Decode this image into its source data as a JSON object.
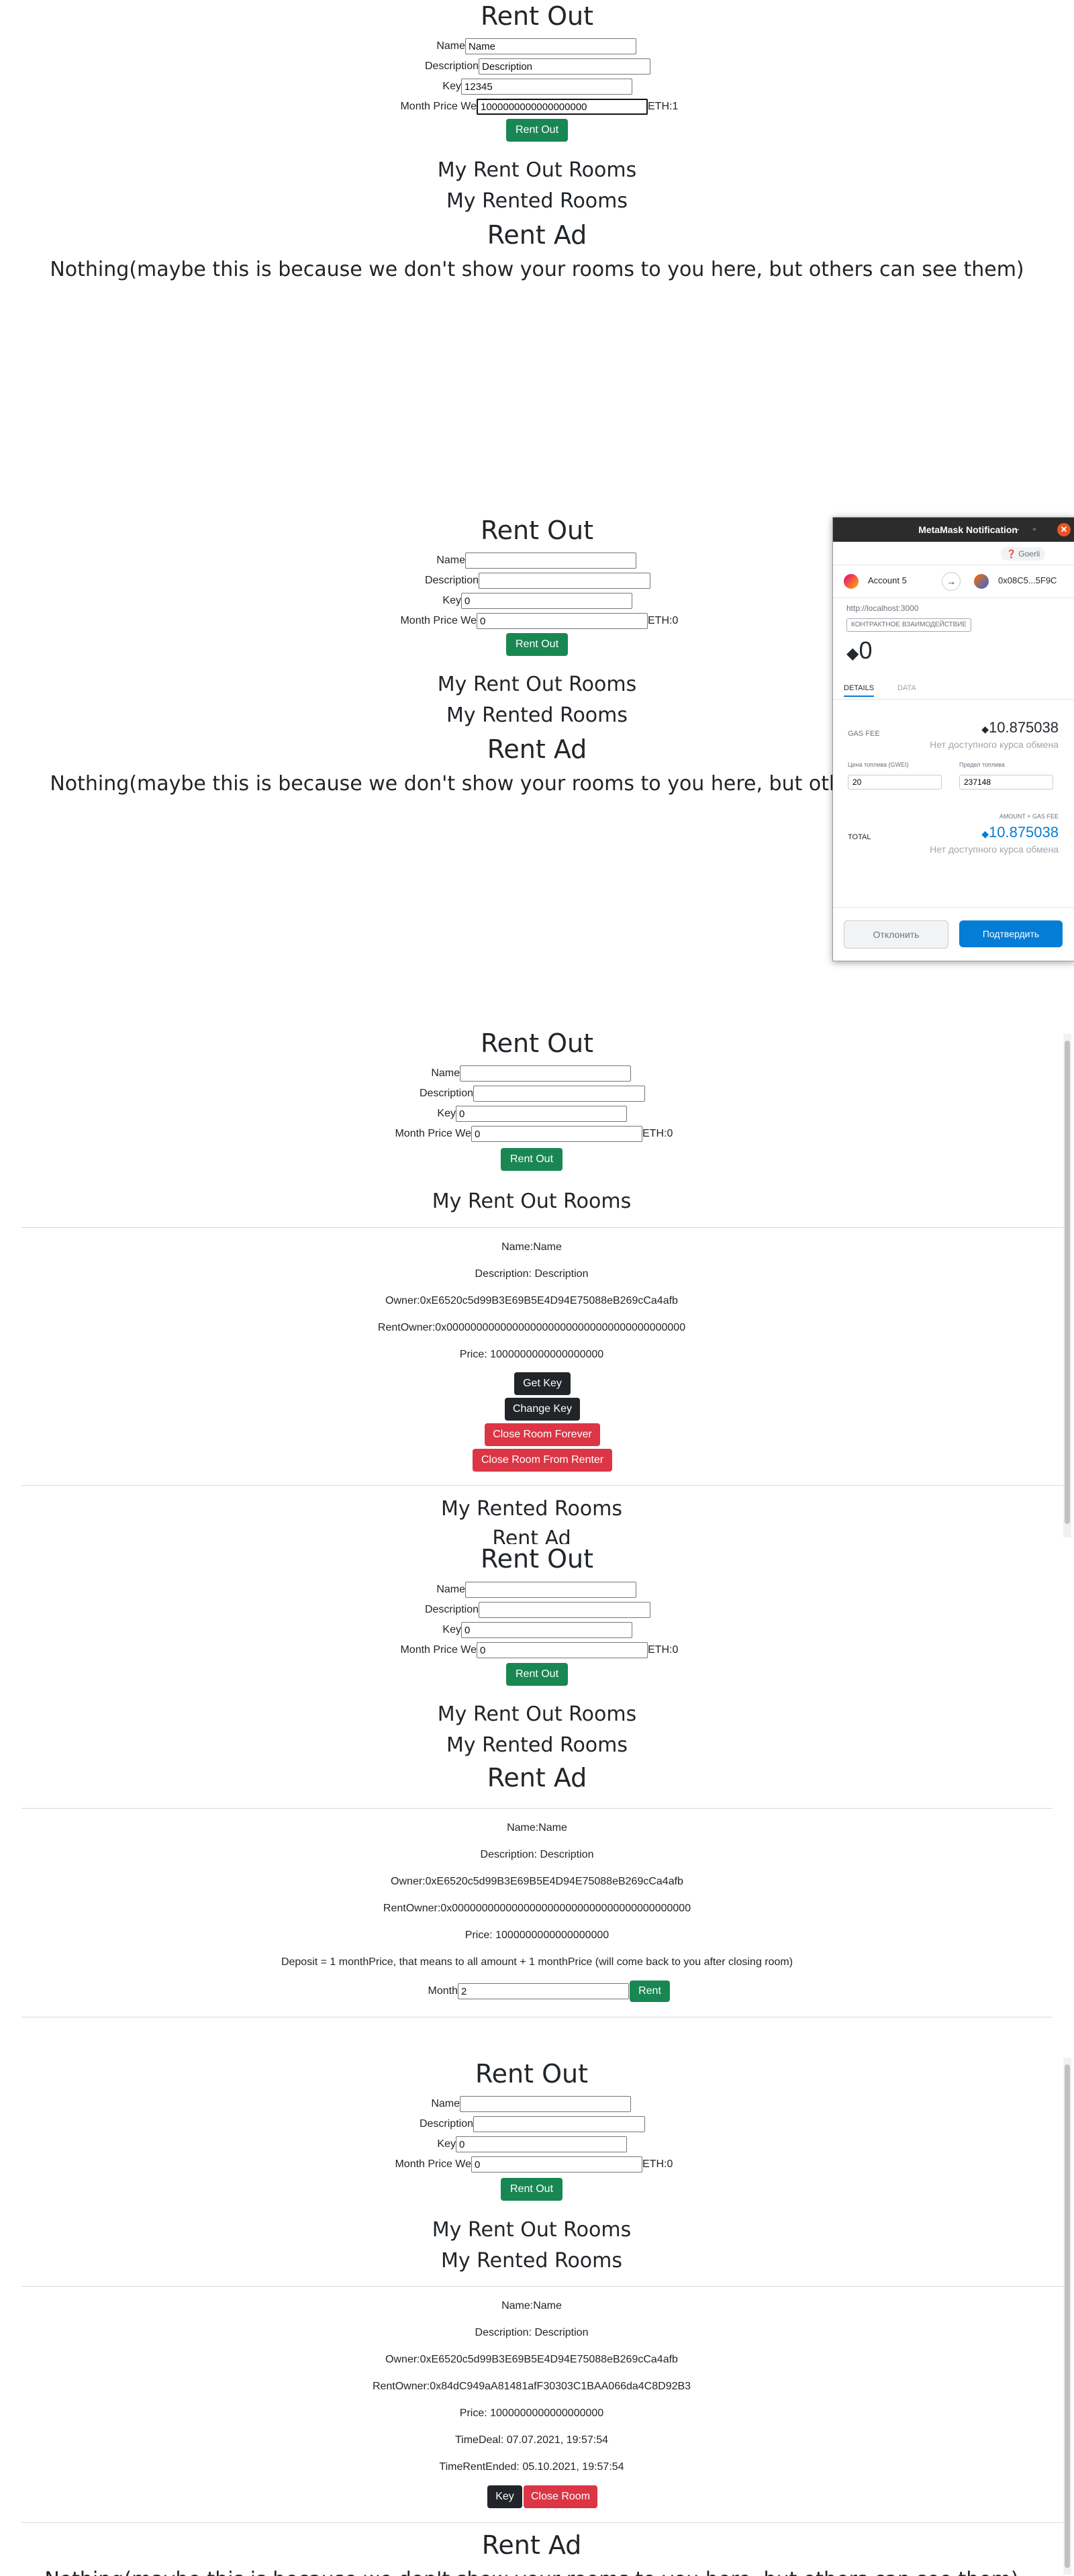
{
  "form": {
    "title": "Rent Out",
    "name_label": "Name",
    "description_label": "Description",
    "key_label": "Key",
    "price_label": "Month Price We",
    "eth_prefix": "ETH:",
    "submit_label": "Rent Out"
  },
  "sections": {
    "my_rent_out_rooms": "My Rent Out Rooms",
    "my_rented_rooms": "My Rented Rooms",
    "rent_ad": "Rent Ad"
  },
  "panel1": {
    "name_value": "Name",
    "description_value": "Description",
    "key_value": "12345",
    "price_value": "1000000000000000000",
    "eth_value": "1",
    "nothing_text": "Nothing(maybe this is because we don't show your rooms to you here, but others can see them)"
  },
  "panel2": {
    "key_value": "0",
    "price_value": "0",
    "eth_value": "0",
    "nothing_text": "Nothing(maybe this is because we don't show your rooms to you here, but others can see them)"
  },
  "metamask": {
    "title": "MetaMask Notification",
    "network": "Goerli",
    "account_from": "Account 5",
    "account_to": "0x08C5...5F9C",
    "origin": "http://localhost:3000",
    "contract_badge": "КОНТРАКТНОЕ ВЗАИМОДЕЙСТВИЕ",
    "amount": "0",
    "tab_details": "DETAILS",
    "tab_data": "DATA",
    "gas_fee_label": "GAS FEE",
    "gas_fee_value": "10.875038",
    "no_rate": "Нет доступного курса обмена",
    "gas_price_label": "Цена топлива (GWEI)",
    "gas_limit_label": "Предел топлива",
    "gas_price_value": "20",
    "gas_limit_value": "237148",
    "amount_gas_label": "AMOUNT + GAS FEE",
    "total_label": "TOTAL",
    "total_value": "10.875038",
    "reject_label": "Отклонить",
    "confirm_label": "Подтвердить"
  },
  "panel3": {
    "key_value": "0",
    "price_value": "0",
    "eth_value": "0",
    "room": {
      "name": "Name:Name",
      "description": "Description: Description",
      "owner": "Owner:0xE6520c5d99B3E69B5E4D94E75088eB269cCa4afb",
      "rent_owner": "RentOwner:0x0000000000000000000000000000000000000000",
      "price": "Price: 1000000000000000000"
    },
    "get_key_label": "Get Key",
    "change_key_label": "Change Key",
    "close_forever_label": "Close Room Forever",
    "close_from_renter_label": "Close Room From Renter"
  },
  "panel4": {
    "key_value": "0",
    "price_value": "0",
    "eth_value": "0",
    "room": {
      "name": "Name:Name",
      "description": "Description: Description",
      "owner": "Owner:0xE6520c5d99B3E69B5E4D94E75088eB269cCa4afb",
      "rent_owner": "RentOwner:0x0000000000000000000000000000000000000000",
      "price": "Price: 1000000000000000000",
      "deposit_note": "Deposit = 1 monthPrice, that means to all amount + 1 monthPrice (will come back to you after closing room)"
    },
    "month_label": "Month",
    "month_value": "2",
    "rent_label": "Rent"
  },
  "panel5": {
    "key_value": "0",
    "price_value": "0",
    "eth_value": "0",
    "room": {
      "name": "Name:Name",
      "description": "Description: Description",
      "owner": "Owner:0xE6520c5d99B3E69B5E4D94E75088eB269cCa4afb",
      "rent_owner": "RentOwner:0x84dC949aA81481afF30303C1BAA066da4C8D92B3",
      "price": "Price: 1000000000000000000",
      "time_deal": "TimeDeal: 07.07.2021, 19:57:54",
      "time_rent_ended": "TimeRentEnded: 05.10.2021, 19:57:54"
    },
    "key_label": "Key",
    "close_room_label": "Close Room",
    "bottom_text": "Nothing(maybe this is because we don't show your rooms to you here, but others can see them)"
  }
}
